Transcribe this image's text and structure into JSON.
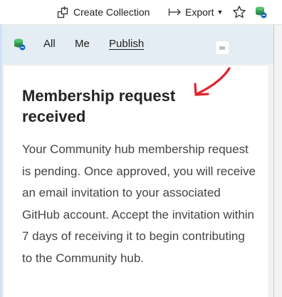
{
  "toolbar": {
    "create_collection_label": "Create Collection",
    "export_label": "Export",
    "icons": [
      "collection-icon",
      "export-arrow-icon",
      "star-icon",
      "community-hub-icon"
    ]
  },
  "tabs": [
    {
      "label": "All"
    },
    {
      "label": "Me"
    },
    {
      "label": "Publish"
    }
  ],
  "notice": {
    "title": "Membership request received",
    "body": "Your Community hub membership request is pending. Once approved, you will receive an email invitation to your associated GitHub account. Accept the invitation within 7 days of receiving it to begin contributing to the Community hub."
  },
  "colors": {
    "annotation": "#e0232a",
    "header_bg": "#e3edf3",
    "hub_icon": "#3aa657"
  }
}
